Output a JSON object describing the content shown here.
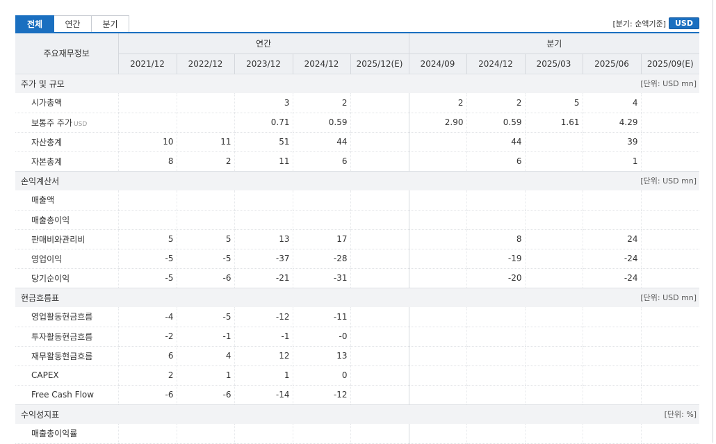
{
  "tabs": [
    "전체",
    "연간",
    "분기"
  ],
  "basis_label": "[분기: 순액기준]",
  "currency": "USD",
  "header": {
    "row_title": "주요재무정보",
    "annual_label": "연간",
    "quarter_label": "분기",
    "periods": [
      "2021/12",
      "2022/12",
      "2023/12",
      "2024/12",
      "2025/12(E)",
      "2024/09",
      "2024/12",
      "2025/03",
      "2025/06",
      "2025/09(E)"
    ]
  },
  "sections": [
    {
      "name": "주가 및 규모",
      "unit": "[단위: USD mn]",
      "rows": [
        {
          "label": "시가총액",
          "values": [
            "",
            "",
            "3",
            "2",
            "",
            "2",
            "2",
            "5",
            "4",
            ""
          ]
        },
        {
          "label": "보통주 주가",
          "sub": "USD",
          "values": [
            "",
            "",
            "0.71",
            "0.59",
            "",
            "2.90",
            "0.59",
            "1.61",
            "4.29",
            ""
          ]
        },
        {
          "label": "자산총계",
          "values": [
            "10",
            "11",
            "51",
            "44",
            "",
            "",
            "44",
            "",
            "39",
            ""
          ]
        },
        {
          "label": "자본총계",
          "values": [
            "8",
            "2",
            "11",
            "6",
            "",
            "",
            "6",
            "",
            "1",
            ""
          ]
        }
      ]
    },
    {
      "name": "손익계산서",
      "unit": "[단위: USD mn]",
      "rows": [
        {
          "label": "매출액",
          "values": [
            "",
            "",
            "",
            "",
            "",
            "",
            "",
            "",
            "",
            ""
          ]
        },
        {
          "label": "매출총이익",
          "values": [
            "",
            "",
            "",
            "",
            "",
            "",
            "",
            "",
            "",
            ""
          ]
        },
        {
          "label": "판매비와관리비",
          "values": [
            "5",
            "5",
            "13",
            "17",
            "",
            "",
            "8",
            "",
            "24",
            ""
          ]
        },
        {
          "label": "영업이익",
          "values": [
            "-5",
            "-5",
            "-37",
            "-28",
            "",
            "",
            "-19",
            "",
            "-24",
            ""
          ]
        },
        {
          "label": "당기순이익",
          "values": [
            "-5",
            "-6",
            "-21",
            "-31",
            "",
            "",
            "-20",
            "",
            "-24",
            ""
          ]
        }
      ]
    },
    {
      "name": "현금흐름표",
      "unit": "[단위: USD mn]",
      "rows": [
        {
          "label": "영업활동현금흐름",
          "values": [
            "-4",
            "-5",
            "-12",
            "-11",
            "",
            "",
            "",
            "",
            "",
            ""
          ]
        },
        {
          "label": "투자활동현금흐름",
          "values": [
            "-2",
            "-1",
            "-1",
            "-0",
            "",
            "",
            "",
            "",
            "",
            ""
          ]
        },
        {
          "label": "재무활동현금흐름",
          "values": [
            "6",
            "4",
            "12",
            "13",
            "",
            "",
            "",
            "",
            "",
            ""
          ]
        },
        {
          "label": "CAPEX",
          "values": [
            "2",
            "1",
            "1",
            "0",
            "",
            "",
            "",
            "",
            "",
            ""
          ]
        },
        {
          "label": "Free Cash Flow",
          "values": [
            "-6",
            "-6",
            "-14",
            "-12",
            "",
            "",
            "",
            "",
            "",
            ""
          ]
        }
      ]
    },
    {
      "name": "수익성지표",
      "unit": "[단위: %]",
      "rows": [
        {
          "label": "매출총이익률",
          "values": [
            "",
            "",
            "",
            "",
            "",
            "",
            "",
            "",
            "",
            ""
          ]
        }
      ]
    }
  ]
}
